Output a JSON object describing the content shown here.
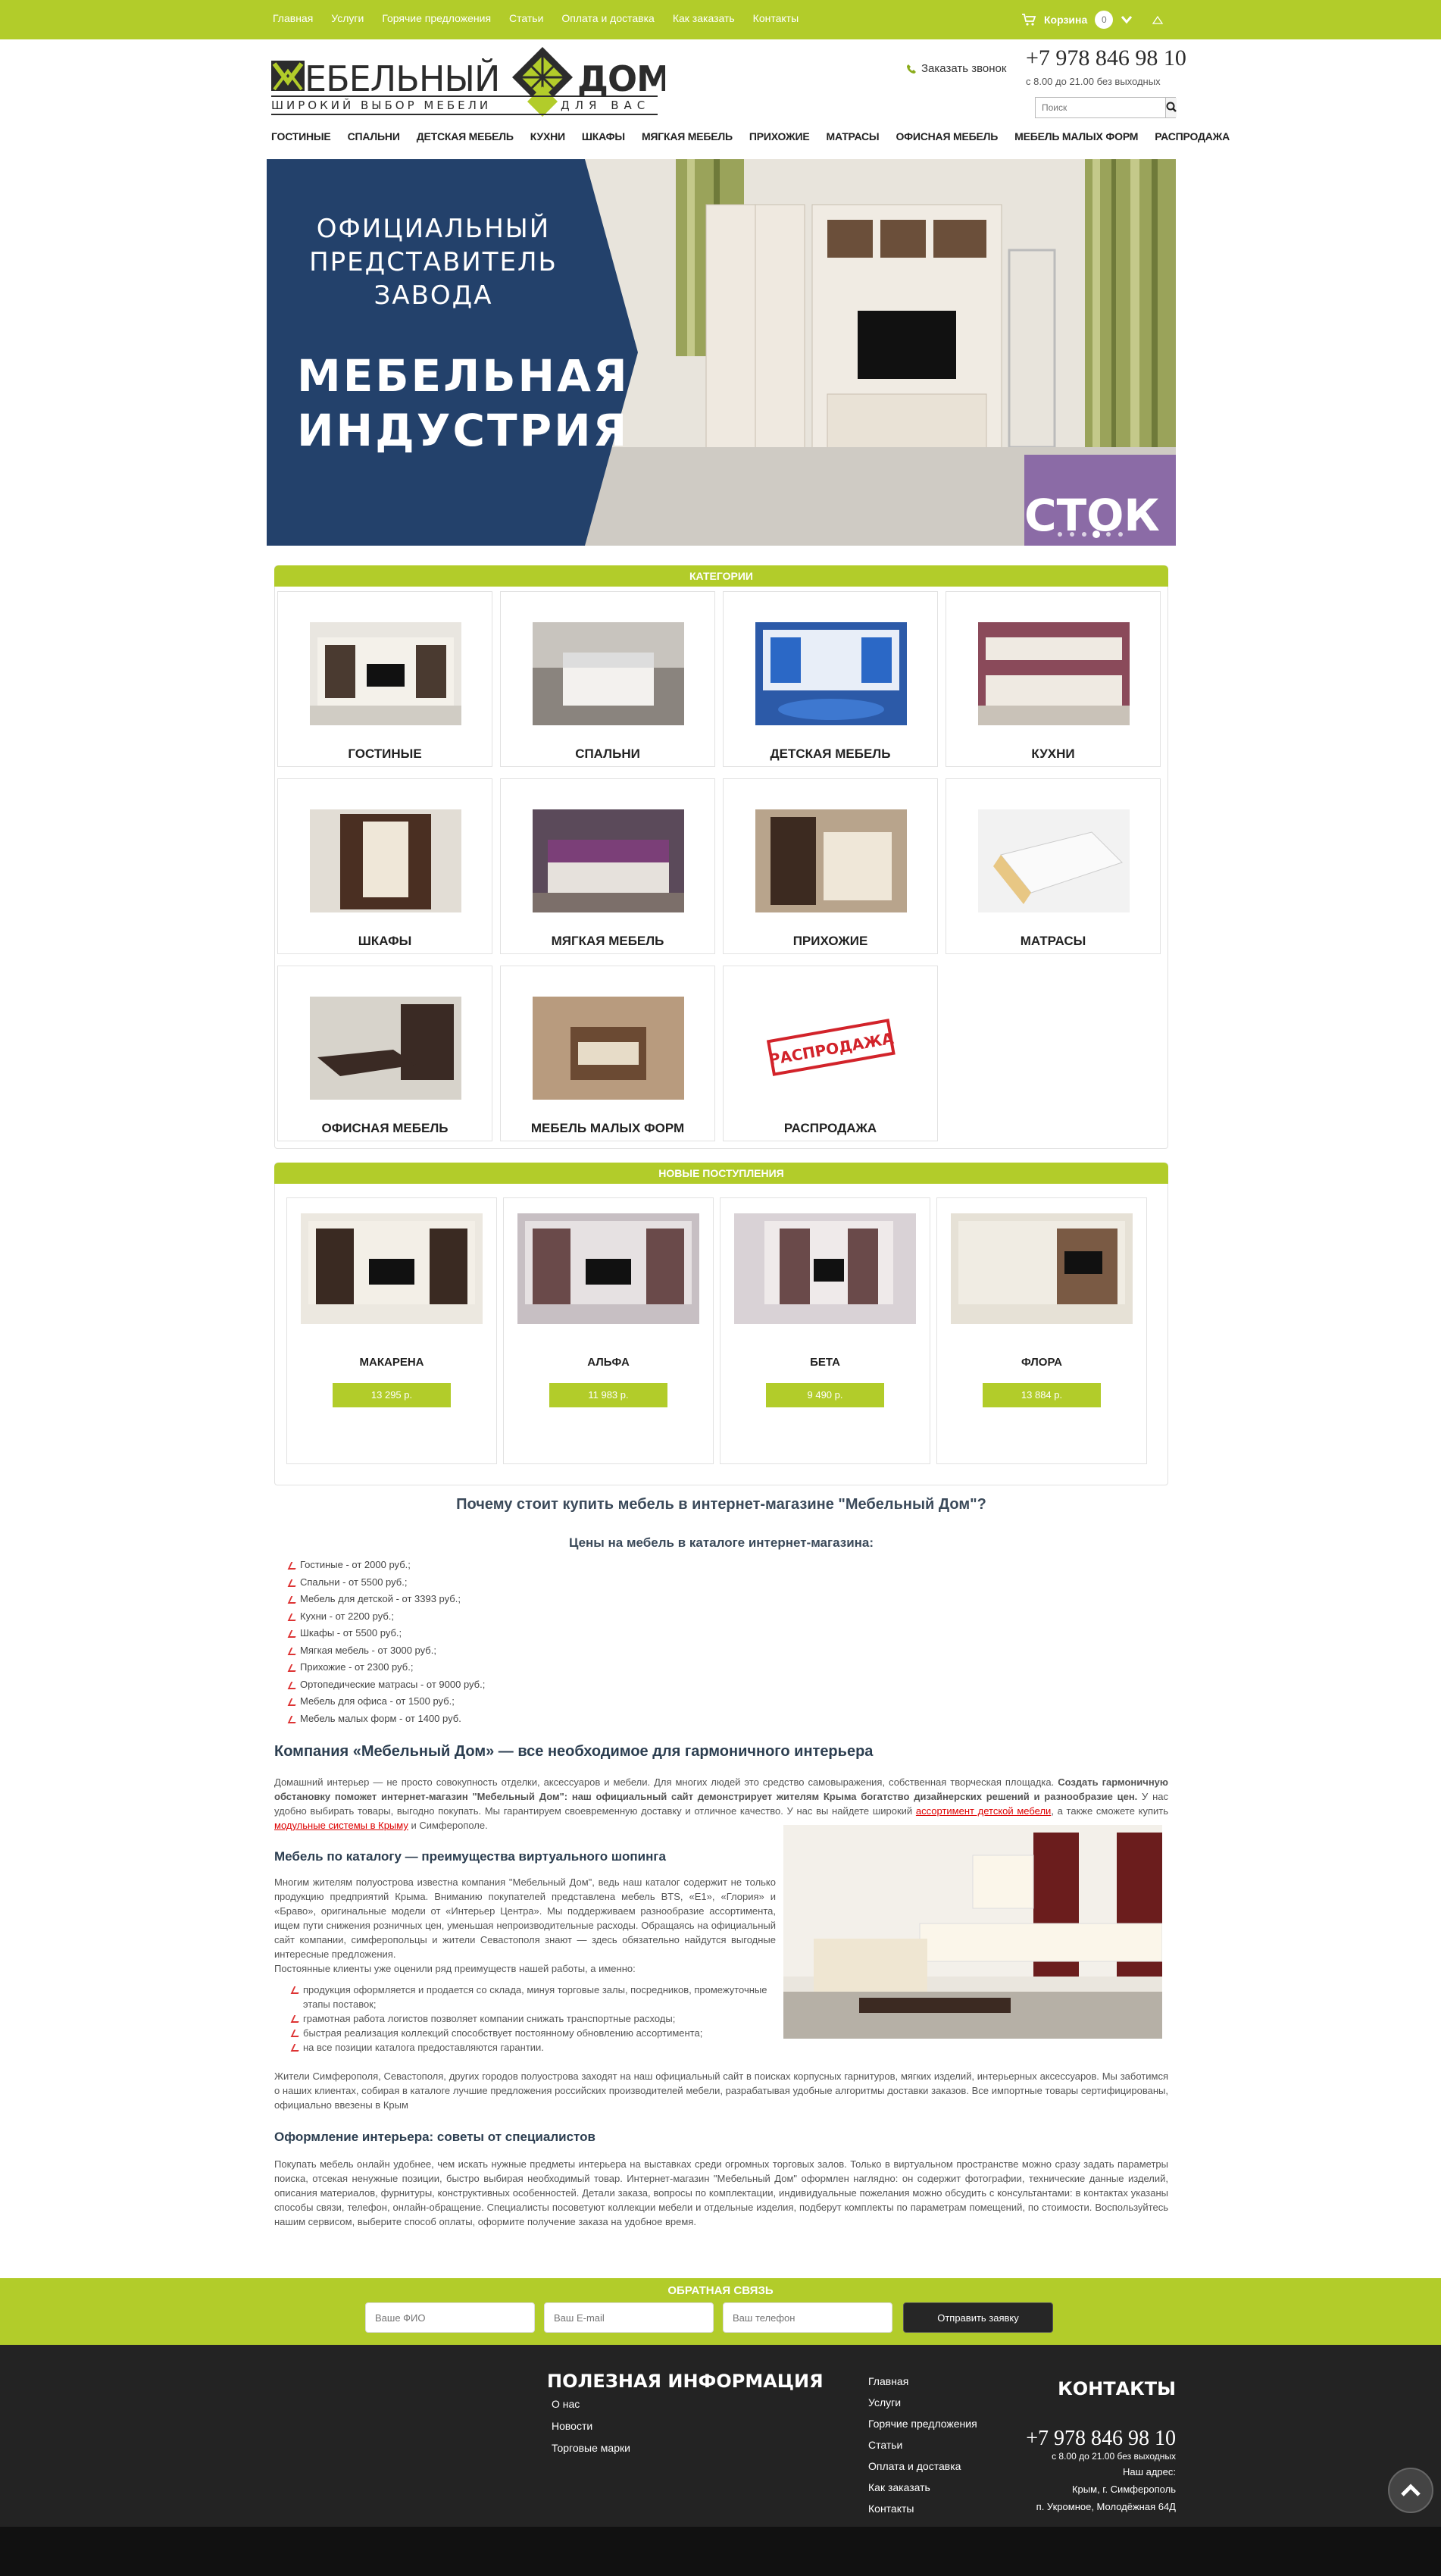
{
  "topbar": {
    "nav": [
      "Главная",
      "Услуги",
      "Горячие предложения",
      "Статьи",
      "Оплата и доставка",
      "Как заказать",
      "Контакты"
    ],
    "cart_label": "Корзина",
    "cart_count": "0"
  },
  "header": {
    "logo_word1": "МЕБЕЛЬНЫЙ",
    "logo_word2": "ДОМ",
    "logo_tagline1": "ШИРОКИЙ ВЫБОР МЕБЕЛИ",
    "logo_tagline2": "ДЛЯ ВАС",
    "callback": "Заказать звонок",
    "phone": "+7 978 846 98 10",
    "hours": "с 8.00 до 21.00 без выходных",
    "search_placeholder": "Поиск"
  },
  "mainnav": [
    "ГОСТИНЫЕ",
    "СПАЛЬНИ",
    "ДЕТСКАЯ МЕБЕЛЬ",
    "КУХНИ",
    "ШКАФЫ",
    "МЯГКАЯ МЕБЕЛЬ",
    "ПРИХОЖИЕ",
    "МАТРАСЫ",
    "ОФИСНАЯ МЕБЕЛЬ",
    "МЕБЕЛЬ МАЛЫХ ФОРМ",
    "РАСПРОДАЖА"
  ],
  "banner": {
    "line1": "ОФИЦИАЛЬНЫЙ",
    "line2": "ПРЕДСТАВИТЕЛЬ",
    "line3": "ЗАВОДА",
    "line4": "МЕБЕЛЬНАЯ",
    "line5": "ИНДУСТРИЯ",
    "overlay": "СТОК",
    "slide_count": 6,
    "active_slide": 4,
    "colors": {
      "blue": "#23416b",
      "purple": "#7f5aa1"
    }
  },
  "categories": {
    "title": "КАТЕГОРИИ",
    "items": [
      "ГОСТИНЫЕ",
      "СПАЛЬНИ",
      "ДЕТСКАЯ МЕБЕЛЬ",
      "КУХНИ",
      "ШКАФЫ",
      "МЯГКАЯ МЕБЕЛЬ",
      "ПРИХОЖИЕ",
      "МАТРАСЫ",
      "ОФИСНАЯ МЕБЕЛЬ",
      "МЕБЕЛЬ МАЛЫХ ФОРМ",
      "РАСПРОДАЖА"
    ],
    "sale_stamp": "РАСПРОДАЖА"
  },
  "new_arrivals": {
    "title": "НОВЫЕ ПОСТУПЛЕНИЯ",
    "items": [
      {
        "name": "МАКАРЕНА",
        "price": "13 295 р."
      },
      {
        "name": "АЛЬФА",
        "price": "11 983 р."
      },
      {
        "name": "БЕТА",
        "price": "9 490 р."
      },
      {
        "name": "ФЛОРА",
        "price": "13 884 р."
      }
    ]
  },
  "why": {
    "title": "Почему стоит купить мебель в интернет-магазине \"Мебельный Дом\"?",
    "subtitle": "Цены на мебель в каталоге интернет-магазина:",
    "prices": [
      "Гостиные - от 2000 руб.;",
      "Спальни - от 5500 руб.;",
      "Мебель для детской - от 3393 руб.;",
      "Кухни - от 2200 руб.;",
      "Шкафы - от 5500 руб.;",
      "Мягкая мебель - от 3000 руб.;",
      "Прихожие - от 2300 руб.;",
      "Ортопедические матрасы - от 9000 руб.;",
      "Мебель для офиса - от 1500 руб.;",
      "Мебель малых форм - от 1400 руб."
    ]
  },
  "article": {
    "h1": "Компания «Мебельный Дом» — все необходимое для гармоничного интерьера",
    "p1_a": "Домашний интерьер — не просто совокупность отделки, аксессуаров и мебели. Для многих людей это средство самовыражения, собственная творческая площадка. ",
    "p1_b": "Создать гармоничную обстановку поможет интернет-магазин \"Мебельный Дом\": наш официальный сайт демонстрирует жителям Крыма богатство дизайнерских решений и разнообразие цен.",
    "p1_c": " У нас удобно выбирать товары, выгодно покупать. Мы гарантируем своевременную доставку и отличное качество. У нас вы найдете широкий ",
    "p1_link1": "ассортимент детской мебели",
    "p1_d": ", а также сможете купить ",
    "p1_link2": "модульные системы в Крыму",
    "p1_e": " и Симферополе.",
    "h2": "Мебель по каталогу — преимущества виртуального шопинга",
    "p2": "Многим жителям полуострова известна компания \"Мебельный Дом\", ведь наш каталог содержит не только продукцию предприятий Крыма. Вниманию покупателей представлена мебель BTS, «Е1», «Глория» и «Браво», оригинальные модели от «Интерьер Центра». Мы поддерживаем разнообразие ассортимента, ищем пути снижения розничных цен, уменьшая непроизводительные расходы. Обращаясь на официальный сайт компании, симферопольцы и жители Севастополя знают — здесь обязательно найдутся выгодные интересные предложения.",
    "p3": "Постоянные клиенты уже оценили ряд преимуществ нашей работы, а именно:",
    "bullets": [
      "продукция оформляется и продается со склада, минуя торговые залы, посредников, промежуточные этапы поставок;",
      "грамотная работа логистов позволяет компании снижать транспортные расходы;",
      "быстрая реализация коллекций способствует постоянному обновлению ассортимента;",
      "на все позиции каталога предоставляются гарантии."
    ],
    "p4": "Жители Симферополя, Севастополя, других городов полуострова заходят на наш официальный сайт в поисках корпусных гарнитуров, мягких изделий, интерьерных аксессуаров. Мы заботимся о наших клиентах, собирая в каталоге лучшие предложения российских производителей мебели, разрабатывая удобные алгоритмы доставки заказов. Все импортные товары сертифицированы, официально ввезены в Крым",
    "h3": "Оформление интерьера: советы от специалистов",
    "p5": "Покупать мебель онлайн удобнее, чем искать нужные предметы интерьера на выставках среди огромных торговых залов. Только в виртуальном пространстве можно сразу задать параметры поиска, отсекая ненужные позиции, быстро выбирая необходимый товар. Интернет-магазин \"Мебельный Дом\" оформлен наглядно: он содержит фотографии, технические данные изделий, описания материалов, фурнитуры, конструктивных особенностей. Детали заказа, вопросы по комплектации, индивидуальные пожелания можно обсудить с консультантами: в контактах указаны способы связи, телефон, онлайн-обращение. Специалисты посоветуют коллекции мебели и отдельные изделия, подберут комплекты по параметрам помещений, по стоимости. Воспользуйтесь нашим сервисом, выберите способ оплаты, оформите получение заказа на удобное время."
  },
  "feedback": {
    "title": "ОБРАТНАЯ СВЯЗЬ",
    "name_placeholder": "Ваше ФИО",
    "email_placeholder": "Ваш E-mail",
    "phone_placeholder": "Ваш телефон",
    "submit": "Отправить заявку"
  },
  "footer": {
    "info_title": "ПОЛЕЗНАЯ ИНФОРМАЦИЯ",
    "info_links": [
      "О нас",
      "Новости",
      "Торговые марки"
    ],
    "nav_links": [
      "Главная",
      "Услуги",
      "Горячие предложения",
      "Статьи",
      "Оплата и доставка",
      "Как заказать",
      "Контакты"
    ],
    "contacts_title": "КОНТАКТЫ",
    "phone": "+7 978 846 98 10",
    "hours": "с 8.00 до 21.00 без выходных",
    "address_label": "Наш адрес:",
    "address_city": "Крым, г. Симферополь",
    "address_street": "п. Укромное, Молодёжная 64Д"
  },
  "colors": {
    "accent": "#b2cc2a",
    "dark": "#232323",
    "heading": "#2c3e50"
  }
}
